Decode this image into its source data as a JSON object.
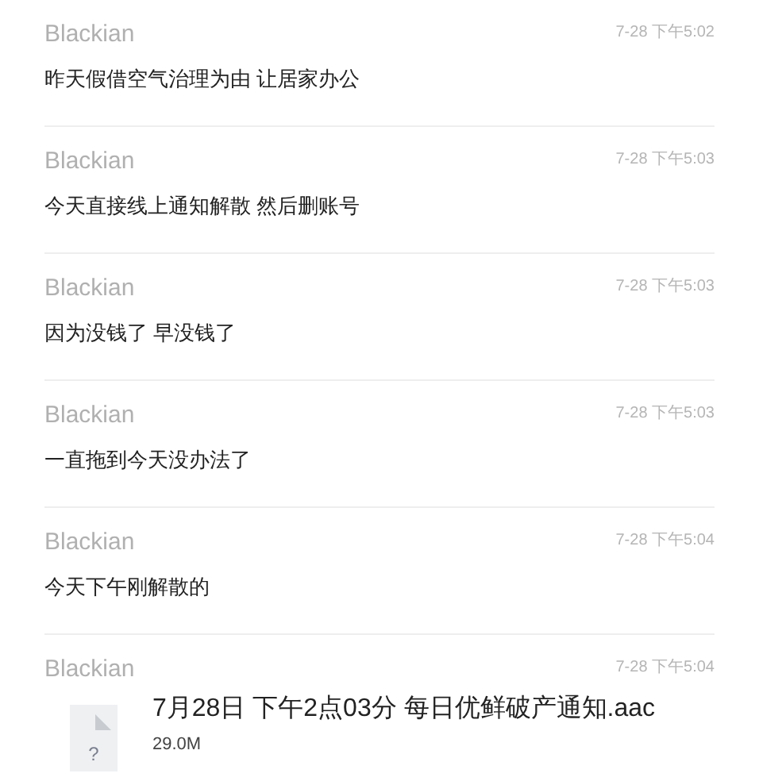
{
  "messages": [
    {
      "kind": "text",
      "sender": "Blackian",
      "time": "7-28 下午5:02",
      "text": "昨天假借空气治理为由 让居家办公"
    },
    {
      "kind": "text",
      "sender": "Blackian",
      "time": "7-28 下午5:03",
      "text": "今天直接线上通知解散 然后删账号"
    },
    {
      "kind": "text",
      "sender": "Blackian",
      "time": "7-28 下午5:03",
      "text": "因为没钱了 早没钱了"
    },
    {
      "kind": "text",
      "sender": "Blackian",
      "time": "7-28 下午5:03",
      "text": "一直拖到今天没办法了"
    },
    {
      "kind": "text",
      "sender": "Blackian",
      "time": "7-28 下午5:04",
      "text": "今天下午刚解散的"
    },
    {
      "kind": "file",
      "sender": "Blackian",
      "time": "7-28 下午5:04",
      "file_icon": "?",
      "file_name": "7月28日 下午2点03分 每日优鲜破产通知.aac",
      "file_size": "29.0M"
    }
  ]
}
